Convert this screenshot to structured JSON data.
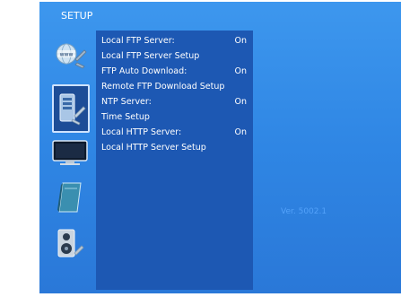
{
  "screen": {
    "title": "SETUP",
    "version": "Ver. 5002.1"
  },
  "sidebar": {
    "icons": [
      {
        "name": "web-globe-icon"
      },
      {
        "name": "network-tools-icon",
        "selected": true
      },
      {
        "name": "display-monitor-icon"
      },
      {
        "name": "manual-book-icon"
      },
      {
        "name": "speaker-audio-icon"
      }
    ]
  },
  "menu": {
    "items": [
      {
        "label": "Local FTP Server:",
        "value": "On"
      },
      {
        "label": "Local FTP Server Setup",
        "value": ""
      },
      {
        "label": "FTP Auto Download:",
        "value": "On"
      },
      {
        "label": "Remote FTP Download Setup",
        "value": ""
      },
      {
        "label": "NTP Server:",
        "value": "On"
      },
      {
        "label": "Time Setup",
        "value": ""
      },
      {
        "label": "Local HTTP Server:",
        "value": "On"
      },
      {
        "label": "Local HTTP Server Setup",
        "value": ""
      }
    ]
  },
  "colors": {
    "background": "#2f86e4",
    "menu_panel": "#1d58b3",
    "text": "#ffffff"
  }
}
